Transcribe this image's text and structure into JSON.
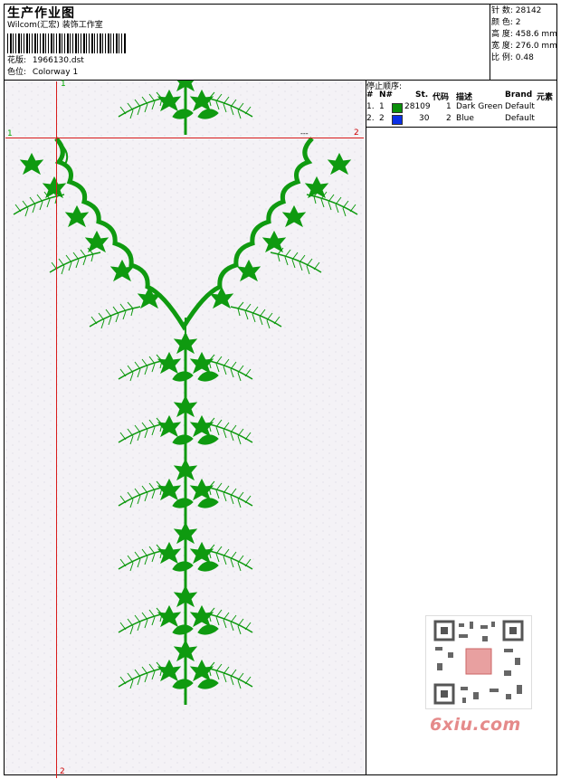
{
  "header": {
    "title": "生产作业图",
    "company": "Wilcom(汇宏) 装饰工作室",
    "design_label": "花版:",
    "design_value": "1966130.dst",
    "color_label": "色位:",
    "color_value": "Colorway 1"
  },
  "stats": {
    "stitches_label": "针 数:",
    "stitches_value": "28142",
    "colors_label": "颜 色:",
    "colors_value": "2",
    "height_label": "高 度:",
    "height_value": "458.6 mm",
    "width_label": "宽 度:",
    "width_value": "276.0 mm",
    "ratio_label": "比 例:",
    "ratio_value": "0.48"
  },
  "markers": {
    "top_left": "1",
    "left_mid": "1",
    "right_mid": "2",
    "bottom": "2",
    "dash": "---"
  },
  "stop_sequence": {
    "title": "停止顺序:",
    "headers": [
      "#",
      "N#",
      "St.",
      "代码",
      "描述",
      "Brand",
      "元素"
    ],
    "rows": [
      {
        "idx": "1.",
        "n": "1",
        "color": "#0a8f0a",
        "st": "28109",
        "code": "1",
        "desc": "Dark Green",
        "brand": "Default"
      },
      {
        "idx": "2.",
        "n": "2",
        "color": "#0a2fe6",
        "st": "30",
        "code": "2",
        "desc": "Blue",
        "brand": "Default"
      }
    ]
  },
  "colors": {
    "embroidery": "#0f9a10",
    "guide": "#d81b1b",
    "marker_green": "#00aa00",
    "watermark": "#e58a8a"
  },
  "watermark": {
    "text": "6xiu.com"
  }
}
